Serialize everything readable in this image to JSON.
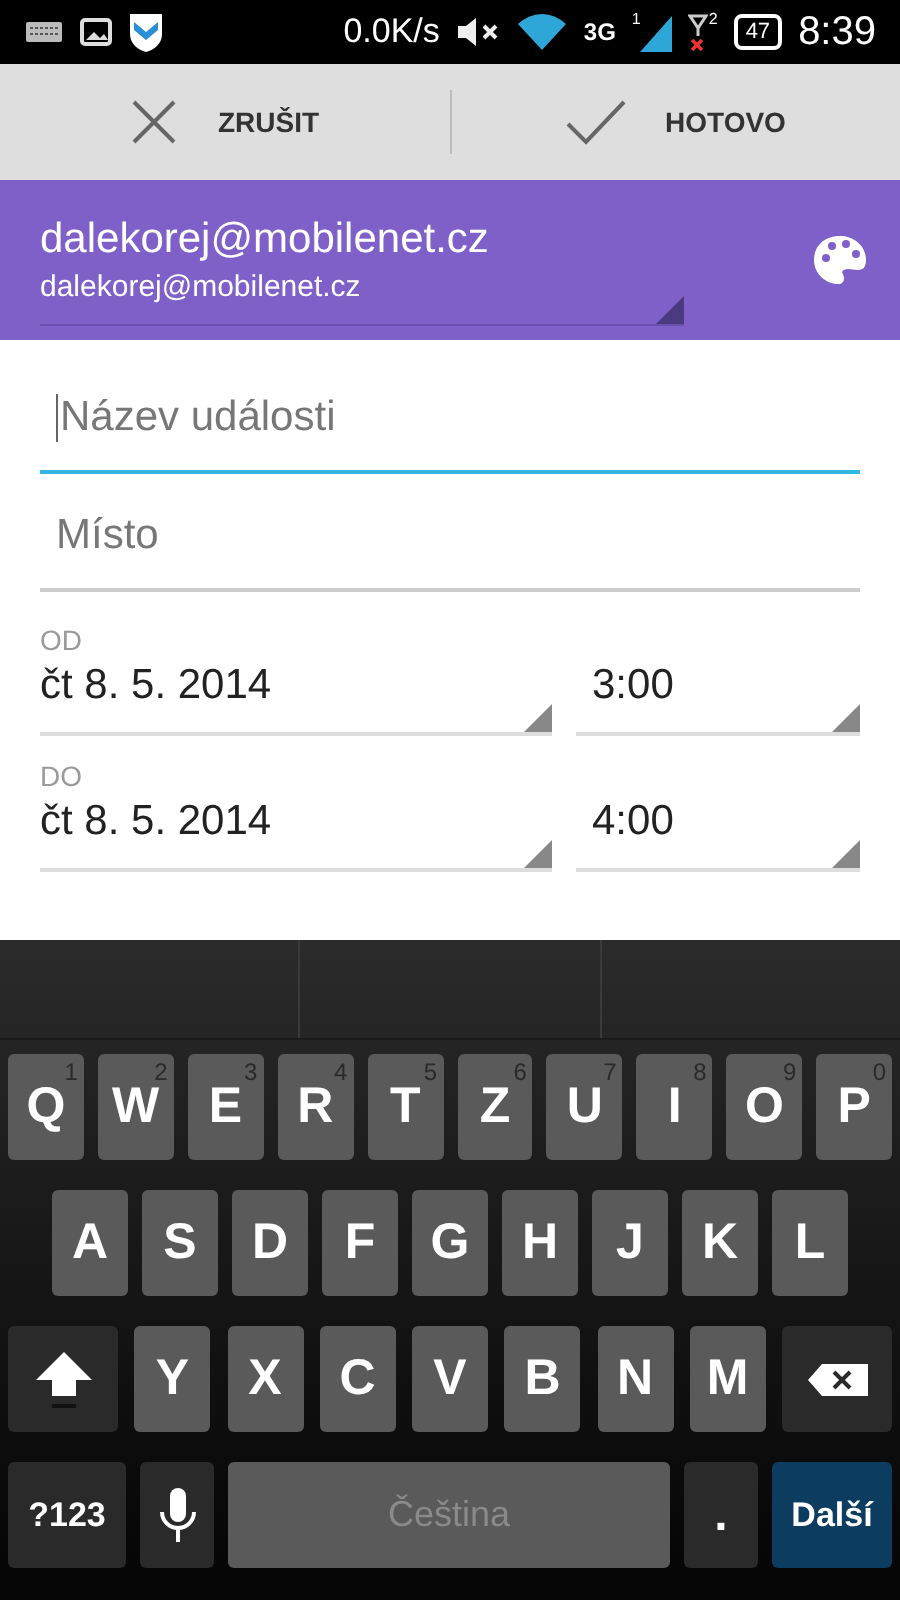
{
  "status_bar": {
    "net_speed": "0.0K/s",
    "network_type": "3G",
    "sim1": "1",
    "sim2": "2",
    "battery": "47",
    "time": "8:39"
  },
  "action_bar": [
    {
      "kind": "cancel",
      "label": "ZRUŠIT"
    },
    {
      "kind": "done",
      "label": "HOTOVO"
    }
  ],
  "account": {
    "name": "dalekorej@mobilenet.cz",
    "email": "dalekorej@mobilenet.cz"
  },
  "fields": [
    {
      "placeholder": "Název události",
      "focused": true
    },
    {
      "placeholder": "Místo",
      "focused": false
    }
  ],
  "time_rows": [
    {
      "label": "OD",
      "date": "čt 8. 5. 2014",
      "time": "3:00"
    },
    {
      "label": "DO",
      "date": "čt 8. 5. 2014",
      "time": "4:00"
    }
  ],
  "keyboard": {
    "top_row": [
      {
        "kind": "letter",
        "label": "Q",
        "hint": "1"
      },
      {
        "kind": "letter",
        "label": "W",
        "hint": "2"
      },
      {
        "kind": "letter",
        "label": "E",
        "hint": "3"
      },
      {
        "kind": "letter",
        "label": "R",
        "hint": "4"
      },
      {
        "kind": "letter",
        "label": "T",
        "hint": "5"
      },
      {
        "kind": "letter",
        "label": "Z",
        "hint": "6"
      },
      {
        "kind": "letter",
        "label": "U",
        "hint": "7"
      },
      {
        "kind": "letter",
        "label": "I",
        "hint": "8"
      },
      {
        "kind": "letter",
        "label": "O",
        "hint": "9"
      },
      {
        "kind": "letter",
        "label": "P",
        "hint": "0"
      }
    ],
    "home_row": [
      {
        "kind": "letter",
        "label": "A"
      },
      {
        "kind": "letter",
        "label": "S"
      },
      {
        "kind": "letter",
        "label": "D"
      },
      {
        "kind": "letter",
        "label": "F"
      },
      {
        "kind": "letter",
        "label": "G"
      },
      {
        "kind": "letter",
        "label": "H"
      },
      {
        "kind": "letter",
        "label": "J"
      },
      {
        "kind": "letter",
        "label": "K"
      },
      {
        "kind": "letter",
        "label": "L"
      }
    ],
    "bottom_row": [
      {
        "kind": "shift"
      },
      {
        "kind": "letter",
        "label": "Y"
      },
      {
        "kind": "letter",
        "label": "X"
      },
      {
        "kind": "letter",
        "label": "C"
      },
      {
        "kind": "letter",
        "label": "V"
      },
      {
        "kind": "letter",
        "label": "B"
      },
      {
        "kind": "letter",
        "label": "N"
      },
      {
        "kind": "letter",
        "label": "M"
      },
      {
        "kind": "backspace"
      }
    ],
    "function_row": [
      {
        "kind": "symbols",
        "label": "?123"
      },
      {
        "kind": "mic"
      },
      {
        "kind": "space",
        "label": "Čeština"
      },
      {
        "kind": "period",
        "label": "."
      },
      {
        "kind": "action",
        "label": "Další"
      }
    ]
  }
}
